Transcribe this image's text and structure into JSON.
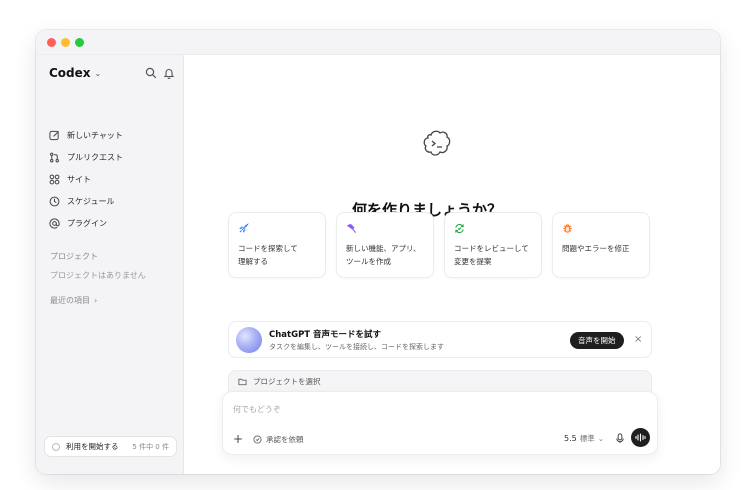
{
  "app": {
    "title": "Codex"
  },
  "sidebar": {
    "items": [
      {
        "label": "新しいチャット",
        "icon": "compose-icon"
      },
      {
        "label": "プルリクエスト",
        "icon": "pull-request-icon"
      },
      {
        "label": "サイト",
        "icon": "grid-icon"
      },
      {
        "label": "スケジュール",
        "icon": "clock-icon"
      },
      {
        "label": "プラグイン",
        "icon": "at-icon"
      }
    ],
    "projects_heading": "プロジェクト",
    "projects_empty": "プロジェクトはありません",
    "recent_label": "最近の項目",
    "get_started": {
      "label": "利用を開始する",
      "progress": "5 件中 0 件"
    }
  },
  "main": {
    "heading": "何を作りましょうか？",
    "cards": [
      {
        "text": "コードを探索して\n理解する",
        "icon": "rocket-icon",
        "color": "#3b82f6"
      },
      {
        "text": "新しい機能、アプリ、\nツールを作成",
        "icon": "hammer-icon",
        "color": "#8b5cf6"
      },
      {
        "text": "コードをレビューして\n変更を提案",
        "icon": "review-icon",
        "color": "#22a447"
      },
      {
        "text": "問題やエラーを修正",
        "icon": "bug-icon",
        "color": "#f97316"
      }
    ],
    "banner": {
      "title": "ChatGPT 音声モードを試す",
      "subtitle": "タスクを編集し、ツールを接続し、コードを探索します",
      "button": "音声を開始",
      "close": "×"
    },
    "project_select": "プロジェクトを選択",
    "composer": {
      "placeholder": "何でもどうぞ",
      "approve_label": "承認を依頼",
      "model": "5.5",
      "model_hint": "標準"
    }
  }
}
